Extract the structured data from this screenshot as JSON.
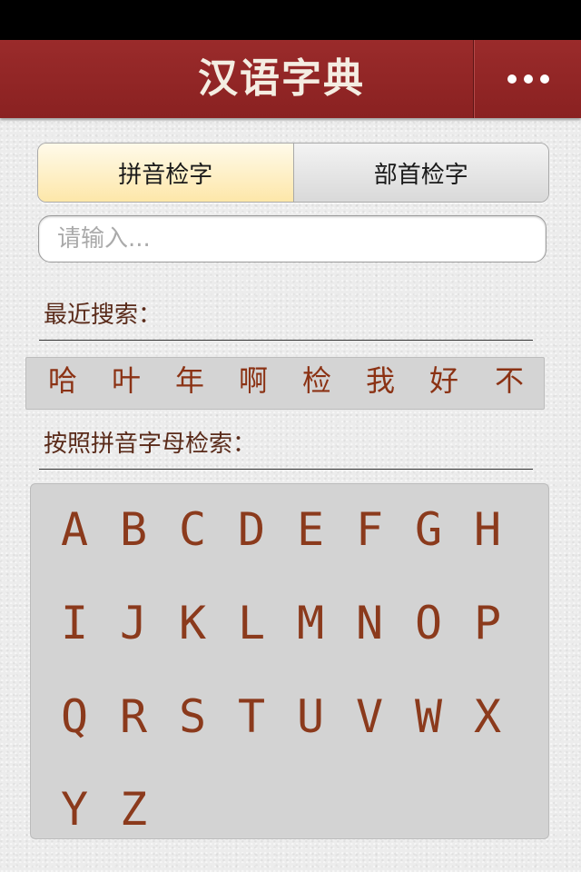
{
  "nav": {
    "title": "汉语字典"
  },
  "tabs": {
    "pinyin": "拼音检字",
    "radical": "部首检字"
  },
  "search": {
    "placeholder": "请输入..."
  },
  "recent": {
    "label": "最近搜索：",
    "items": [
      "哈",
      "叶",
      "年",
      "啊",
      "检",
      "我",
      "好",
      "不"
    ]
  },
  "alphabet": {
    "label": "按照拼音字母检索：",
    "letters": [
      "A",
      "B",
      "C",
      "D",
      "E",
      "F",
      "G",
      "H",
      "I",
      "J",
      "K",
      "L",
      "M",
      "N",
      "O",
      "P",
      "Q",
      "R",
      "S",
      "T",
      "U",
      "V",
      "W",
      "X",
      "Y",
      "Z"
    ]
  }
}
